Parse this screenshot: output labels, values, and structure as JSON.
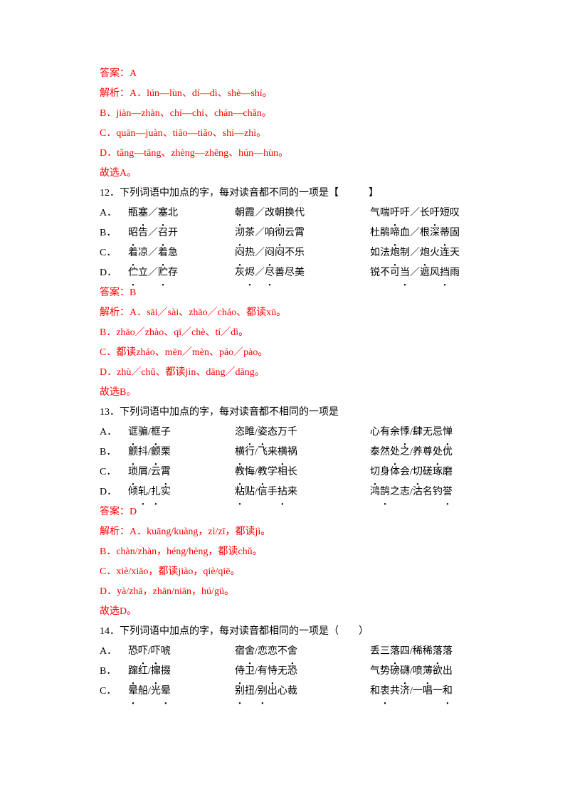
{
  "prev_explanation": {
    "answer_label": "答案：A",
    "jiexi_prefix": "解析：",
    "lines": [
      "A．lún—lùn、dí—dì、shè—shí。",
      "B．jiàn—zhàn、chí—chí、chán—chǎn。",
      "C．quān—juàn、tiāo—tiǎo、shí—zhì。",
      "D．tǎng—tāng、zhèng—zhēng、hún—hùn。"
    ],
    "conclusion": "故选A。"
  },
  "q12": {
    "stem_a": "12．下列词语中加点的字，每对读音都不同的一项是【",
    "stem_b": "】",
    "options": [
      {
        "l": "A．",
        "c1a": "瓶",
        "c1u": "塞",
        "c1b": "／",
        "c1u2": "塞",
        "c1c": "北",
        "c2u": "朝",
        "c2a": "霞／改",
        "c2u2": "朝",
        "c2b": "换代",
        "c3a": "气喘",
        "c3u": "吁",
        "c3b": "吁／长",
        "c3u2": "吁",
        "c3c": "短叹"
      },
      {
        "l": "B．",
        "c1a": "",
        "c1u": "昭",
        "c1b": "告／",
        "c1u2": "召",
        "c1c": "开",
        "c2u": "沏",
        "c2a": "茶／响",
        "c2u2": "彻",
        "c2b": "云霄",
        "c3a": "杜鹃",
        "c3u": "啼",
        "c3b": "血／根深",
        "c3u2": "蒂",
        "c3c": "固"
      },
      {
        "l": "C．",
        "c1a": "",
        "c1u": "着",
        "c1b": "凉／",
        "c1u2": "着",
        "c1c": "急",
        "c2u": "闷",
        "c2a": "热／",
        "c2u2": "闷",
        "c2b": "闷不乐",
        "c3a": "如法",
        "c3u": "炮",
        "c3b": "制／",
        "c3u2": "炮",
        "c3c": "火连天"
      },
      {
        "l": "D．",
        "c1a": "",
        "c1u": "伫",
        "c1b": "立／",
        "c1u2": "贮",
        "c1c": "存",
        "c2u": "",
        "c2a": "灰",
        "c2u2": "烬",
        "c2b": "／",
        "c2u3": "尽",
        "c2c": "善尽美",
        "c3a": "锐不可",
        "c3u": "当",
        "c3b": "／遮风",
        "c3u2": "挡",
        "c3c": "雨"
      }
    ],
    "answer_label": "答案：B",
    "jiexi_prefix": "解析：",
    "jiexi_lines": [
      "A．sāi／sài、zhāo／cháo、都读xū。",
      "B．zhāo／zhào、qī／chè、tí／dì。",
      "C．都读zháo、mēn／mèn、páo／pào。",
      "D．zhù／chǔ、都读jìn、dāng／dǎng。"
    ],
    "conclusion": "故选B。"
  },
  "q13": {
    "stem": "13．下列词语中加点的字，每对读音都不相同的一项是",
    "options": [
      {
        "l": "A．",
        "c1u": "诓",
        "c1a": "骗/",
        "c1u2": "框",
        "c1b": "子",
        "c2a": "恣",
        "c2u": "睢",
        "c2b": "/",
        "c2u2": "姿",
        "c2c": "态万千",
        "c3a": "心有余",
        "c3u": "悸",
        "c3b": "/肆无忌",
        "c3u2": "惮"
      },
      {
        "l": "B．",
        "c1u": "颤",
        "c1a": "抖/",
        "c1u2": "颤",
        "c1b": "栗",
        "c2a": "",
        "c2u": "横",
        "c2b": "行/飞来",
        "c2u2": "横",
        "c2c": "祸",
        "c3a": "泰然",
        "c3u": "处",
        "c3b": "之/养尊",
        "c3u2": "处",
        "c3c": "优"
      },
      {
        "l": "C．",
        "c1u": "琐",
        "c1a": "屑/云",
        "c1u2": "霄",
        "c1b": "",
        "c2a": "",
        "c2u": "教",
        "c2b": "悔/",
        "c2u2": "教",
        "c2c": "学相长",
        "c3a": "",
        "c3u": "切",
        "c3b": "身体会/",
        "c3u2": "切",
        "c3c": "磋琢磨"
      },
      {
        "l": "D．",
        "c1u": "",
        "c1a": "倾",
        "c1u2": "轧",
        "c1b": "/",
        "c1u3": "扎",
        "c1c": "实",
        "c2a": "",
        "c2u": "粘",
        "c2b": "贴/信手",
        "c2u2": "拈",
        "c2c": "来",
        "c3a": "鸿",
        "c3u": "鹄",
        "c3b": "之志/沽名钓",
        "c3u2": "誉",
        "c3c": ""
      }
    ],
    "answer_label": "答案：D",
    "jiexi_prefix": "解析：",
    "jiexi_lines": [
      "A．kuāng/kuàng，zì/zī，都读jì。",
      "B．chàn/zhàn，héng/hèng，都读chǔ。",
      "C．xiè/xiāo，都读jiào，qiè/qiē。",
      "D．yà/zhā，zhān/niān，hú/gū。"
    ],
    "conclusion": "故选D。"
  },
  "q14": {
    "stem": "14．下列词语中加点的字，每对读音都相同的一项是（　　）",
    "options": [
      {
        "l": "A．",
        "c1a": "恐",
        "c1u": "吓",
        "c1b": "/",
        "c1u2": "吓",
        "c1c": "唬",
        "c2a": "宿",
        "c2u": "舍",
        "c2b": "/恋恋不",
        "c2u2": "舍",
        "c3a": "丢三",
        "c3u": "落",
        "c3b": "四/稀稀",
        "c3u2": "落",
        "c3c": "落"
      },
      {
        "l": "B．",
        "c1a": "",
        "c1u": "蹿",
        "c1b": "红/",
        "c1u2": "撺",
        "c1c": "掇",
        "c2a": "",
        "c2u": "侍",
        "c2b": "卫/有",
        "c2u2": "恃",
        "c2c": "无恐",
        "c3a": "气势磅",
        "c3u": "礴",
        "c3b": "/喷",
        "c3u2": "薄",
        "c3c": "欲出"
      },
      {
        "l": "C．",
        "c1a": "",
        "c1u": "晕",
        "c1b": "船/光",
        "c1u2": "晕",
        "c1c": "",
        "c2a": "",
        "c2u": "别",
        "c2b": "扭/",
        "c2u2": "别",
        "c2c": "出心裁",
        "c3a": "和",
        "c3u": "衷",
        "c3b": "共济/一唱一",
        "c3u2": "和",
        "c3c": ""
      }
    ]
  }
}
